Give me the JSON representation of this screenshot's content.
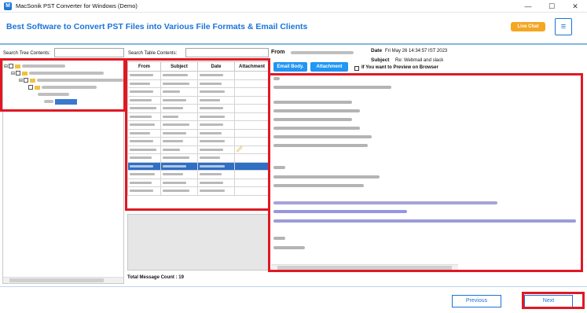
{
  "window": {
    "title": "MacSonik PST Converter for Windows (Demo)",
    "minimize": "—",
    "maximize": "☐",
    "close": "✕",
    "app_icon": "M"
  },
  "banner": {
    "heading": "Best Software to Convert PST Files into Various File Formats & Email Clients",
    "live_chat": "Live Chat",
    "menu_icon": "≡"
  },
  "tree": {
    "search_label": "Search Tree Contents:",
    "search_value": ""
  },
  "table": {
    "search_label": "Search Table Contents:",
    "search_value": "",
    "columns": [
      "From",
      "Subject",
      "Date",
      "Attachment"
    ],
    "attachment_icon": "🖉",
    "total_label": "Total Message Count : 19"
  },
  "message": {
    "from_label": "From",
    "date_label": "Date",
    "date_value": "Fri May 26 14:34:57 IST 2023",
    "subject_label": "Subject",
    "subject_value": "Re: Webmail and slack",
    "email_body_button": "Email Body.",
    "attachment_button": "Attachment",
    "preview_checkbox_label": "If You want to Preview on Browser"
  },
  "footer": {
    "previous": "Previous",
    "next": "Next"
  },
  "colors": {
    "accent": "#1a73d9",
    "highlight": "#e01824",
    "live_chat": "#f5a623",
    "button_blue": "#2196f3"
  }
}
